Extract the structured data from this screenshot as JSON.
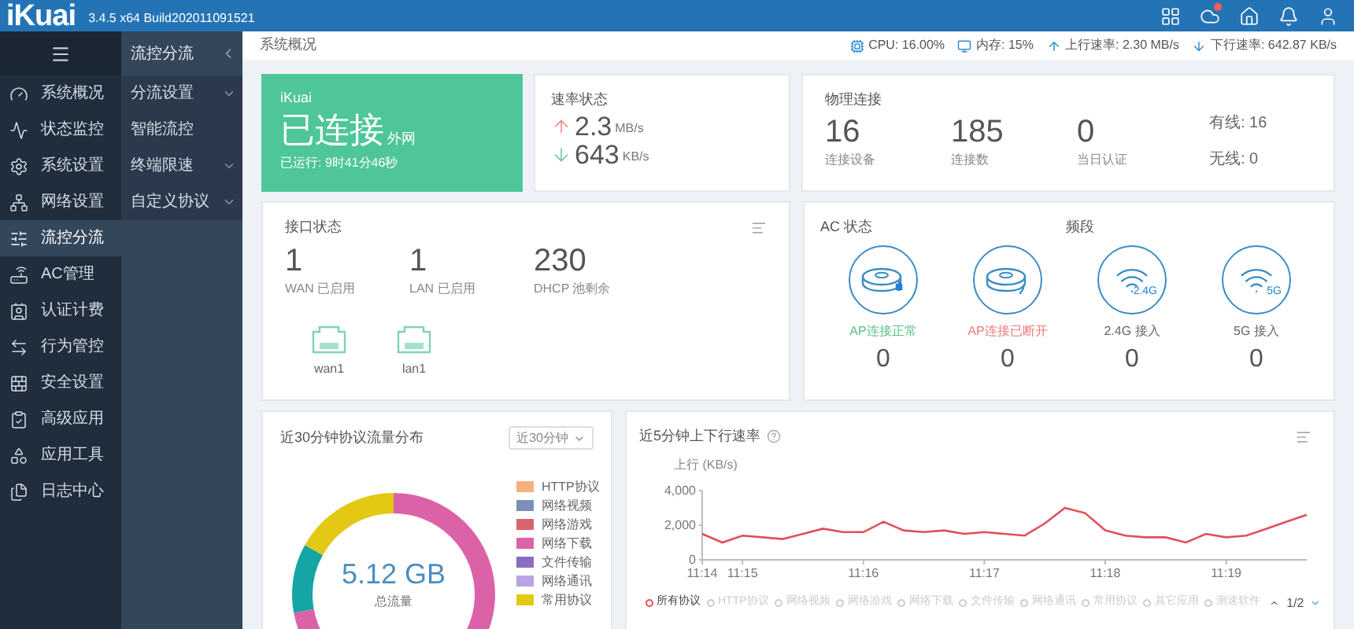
{
  "header": {
    "logo": "iKuai",
    "version": "3.4.5 x64 Build202011091521",
    "toolbar": [
      {
        "kind": "apps",
        "badge": false
      },
      {
        "kind": "cloud",
        "badge": true
      },
      {
        "kind": "home",
        "badge": false
      },
      {
        "kind": "bell",
        "badge": false
      },
      {
        "kind": "user",
        "badge": false
      }
    ]
  },
  "sidebar": {
    "items": [
      {
        "label": "系统概况",
        "selected": false
      },
      {
        "label": "状态监控",
        "selected": false
      },
      {
        "label": "系统设置",
        "selected": false
      },
      {
        "label": "网络设置",
        "selected": false
      },
      {
        "label": "流控分流",
        "selected": true
      },
      {
        "label": "AC管理",
        "selected": false
      },
      {
        "label": "认证计费",
        "selected": false
      },
      {
        "label": "行为管控",
        "selected": false
      },
      {
        "label": "安全设置",
        "selected": false
      },
      {
        "label": "高级应用",
        "selected": false
      },
      {
        "label": "应用工具",
        "selected": false
      },
      {
        "label": "日志中心",
        "selected": false
      }
    ]
  },
  "submenu": {
    "title": "流控分流",
    "items": [
      {
        "label": "分流设置",
        "expandable": true
      },
      {
        "label": "智能流控",
        "expandable": false
      },
      {
        "label": "终端限速",
        "expandable": true
      },
      {
        "label": "自定义协议",
        "expandable": true
      }
    ]
  },
  "breadcrumb": "系统概况",
  "status_bar": [
    {
      "kind": "cpu",
      "text": "CPU: 16.00%"
    },
    {
      "kind": "memory",
      "text": "内存: 15%"
    },
    {
      "kind": "up",
      "text": "上行速率: 2.30 MB/s"
    },
    {
      "kind": "down",
      "text": "下行速率: 642.87 KB/s"
    }
  ],
  "connection": {
    "brand": "iKuai",
    "status": "已连接",
    "network": "外网",
    "uptime": "已运行: 9时41分46秒"
  },
  "speed": {
    "title": "速率状态",
    "rows": [
      {
        "kind": "up",
        "value": "2.3",
        "unit": "MB/s"
      },
      {
        "kind": "down",
        "value": "643",
        "unit": "KB/s"
      }
    ]
  },
  "physical": {
    "title": "物理连接",
    "stats": [
      {
        "value": "16",
        "label": "连接设备"
      },
      {
        "value": "185",
        "label": "连接数"
      },
      {
        "value": "0",
        "label": "当日认证"
      }
    ],
    "wired": "有线: 16",
    "wireless": "无线: 0"
  },
  "interfaces": {
    "title": "接口状态",
    "stats": [
      {
        "value": "1",
        "label": "WAN 已启用"
      },
      {
        "value": "1",
        "label": "LAN 已启用"
      },
      {
        "value": "230",
        "label": "DHCP 池剩余"
      }
    ],
    "ports": [
      "wan1",
      "lan1"
    ]
  },
  "ac": {
    "title": "AC 状态",
    "band_title": "频段",
    "items": [
      {
        "kind": "ap_connected",
        "label": "AP连接正常",
        "color": "#5cc08a",
        "value": "0"
      },
      {
        "kind": "ap_disconnected",
        "label": "AP连接已断开",
        "color": "#f07a7a",
        "value": "0"
      },
      {
        "kind": "wifi",
        "band": "2.4G",
        "label": "2.4G 接入",
        "color": "#666666",
        "value": "0"
      },
      {
        "kind": "wifi",
        "band": "5G",
        "label": "5G 接入",
        "color": "#666666",
        "value": "0"
      }
    ]
  },
  "protocol_chart": {
    "title": "近30分钟协议流量分布",
    "range": "近30分钟",
    "total": "5.12 GB",
    "total_label": "总流量",
    "legend": [
      {
        "label": "HTTP协议",
        "color": "#f5b27e"
      },
      {
        "label": "网络视频",
        "color": "#7b8fb8"
      },
      {
        "label": "网络游戏",
        "color": "#d9646e"
      },
      {
        "label": "网络下载",
        "color": "#dc62a8"
      },
      {
        "label": "文件传输",
        "color": "#8a6cc2"
      },
      {
        "label": "网络通讯",
        "color": "#b9a3e3"
      },
      {
        "label": "常用协议",
        "color": "#e3c814"
      }
    ]
  },
  "rate_chart": {
    "title": "近5分钟上下行速率",
    "chart_data": {
      "type": "line",
      "ylabel": "上行 (KB/s)",
      "categories": [
        "11:14",
        null,
        "11:15",
        null,
        null,
        null,
        null,
        null,
        "11:16",
        null,
        null,
        null,
        null,
        null,
        "11:17",
        null,
        null,
        null,
        null,
        null,
        "11:18",
        null,
        null,
        null,
        null,
        null,
        "11:19",
        null,
        null,
        null,
        null
      ],
      "series": [
        {
          "color": "#e0505a",
          "values": [
            1500,
            1000,
            1400,
            1300,
            1200,
            1500,
            1800,
            1600,
            1600,
            2200,
            1700,
            1600,
            1700,
            1500,
            1600,
            1500,
            1400,
            2100,
            3000,
            2700,
            1700,
            1400,
            1300,
            1300,
            1000,
            1500,
            1300,
            1400,
            1800,
            2200,
            2600
          ]
        }
      ],
      "ylim": [
        0,
        4000
      ],
      "yticks": [
        {
          "value": 0,
          "label": "0"
        },
        {
          "value": 2000,
          "label": "2,000"
        },
        {
          "value": 4000,
          "label": "4,000"
        }
      ]
    },
    "legend": [
      {
        "label": "所有协议",
        "selected": true
      },
      {
        "label": "HTTP协议",
        "selected": false
      },
      {
        "label": "网络视频",
        "selected": false
      },
      {
        "label": "网络游戏",
        "selected": false
      },
      {
        "label": "网络下载",
        "selected": false
      },
      {
        "label": "文件传输",
        "selected": false
      },
      {
        "label": "网络通讯",
        "selected": false
      },
      {
        "label": "常用协议",
        "selected": false
      },
      {
        "label": "其它应用",
        "selected": false
      },
      {
        "label": "测速软件",
        "selected": false
      }
    ],
    "page": "1/2"
  }
}
